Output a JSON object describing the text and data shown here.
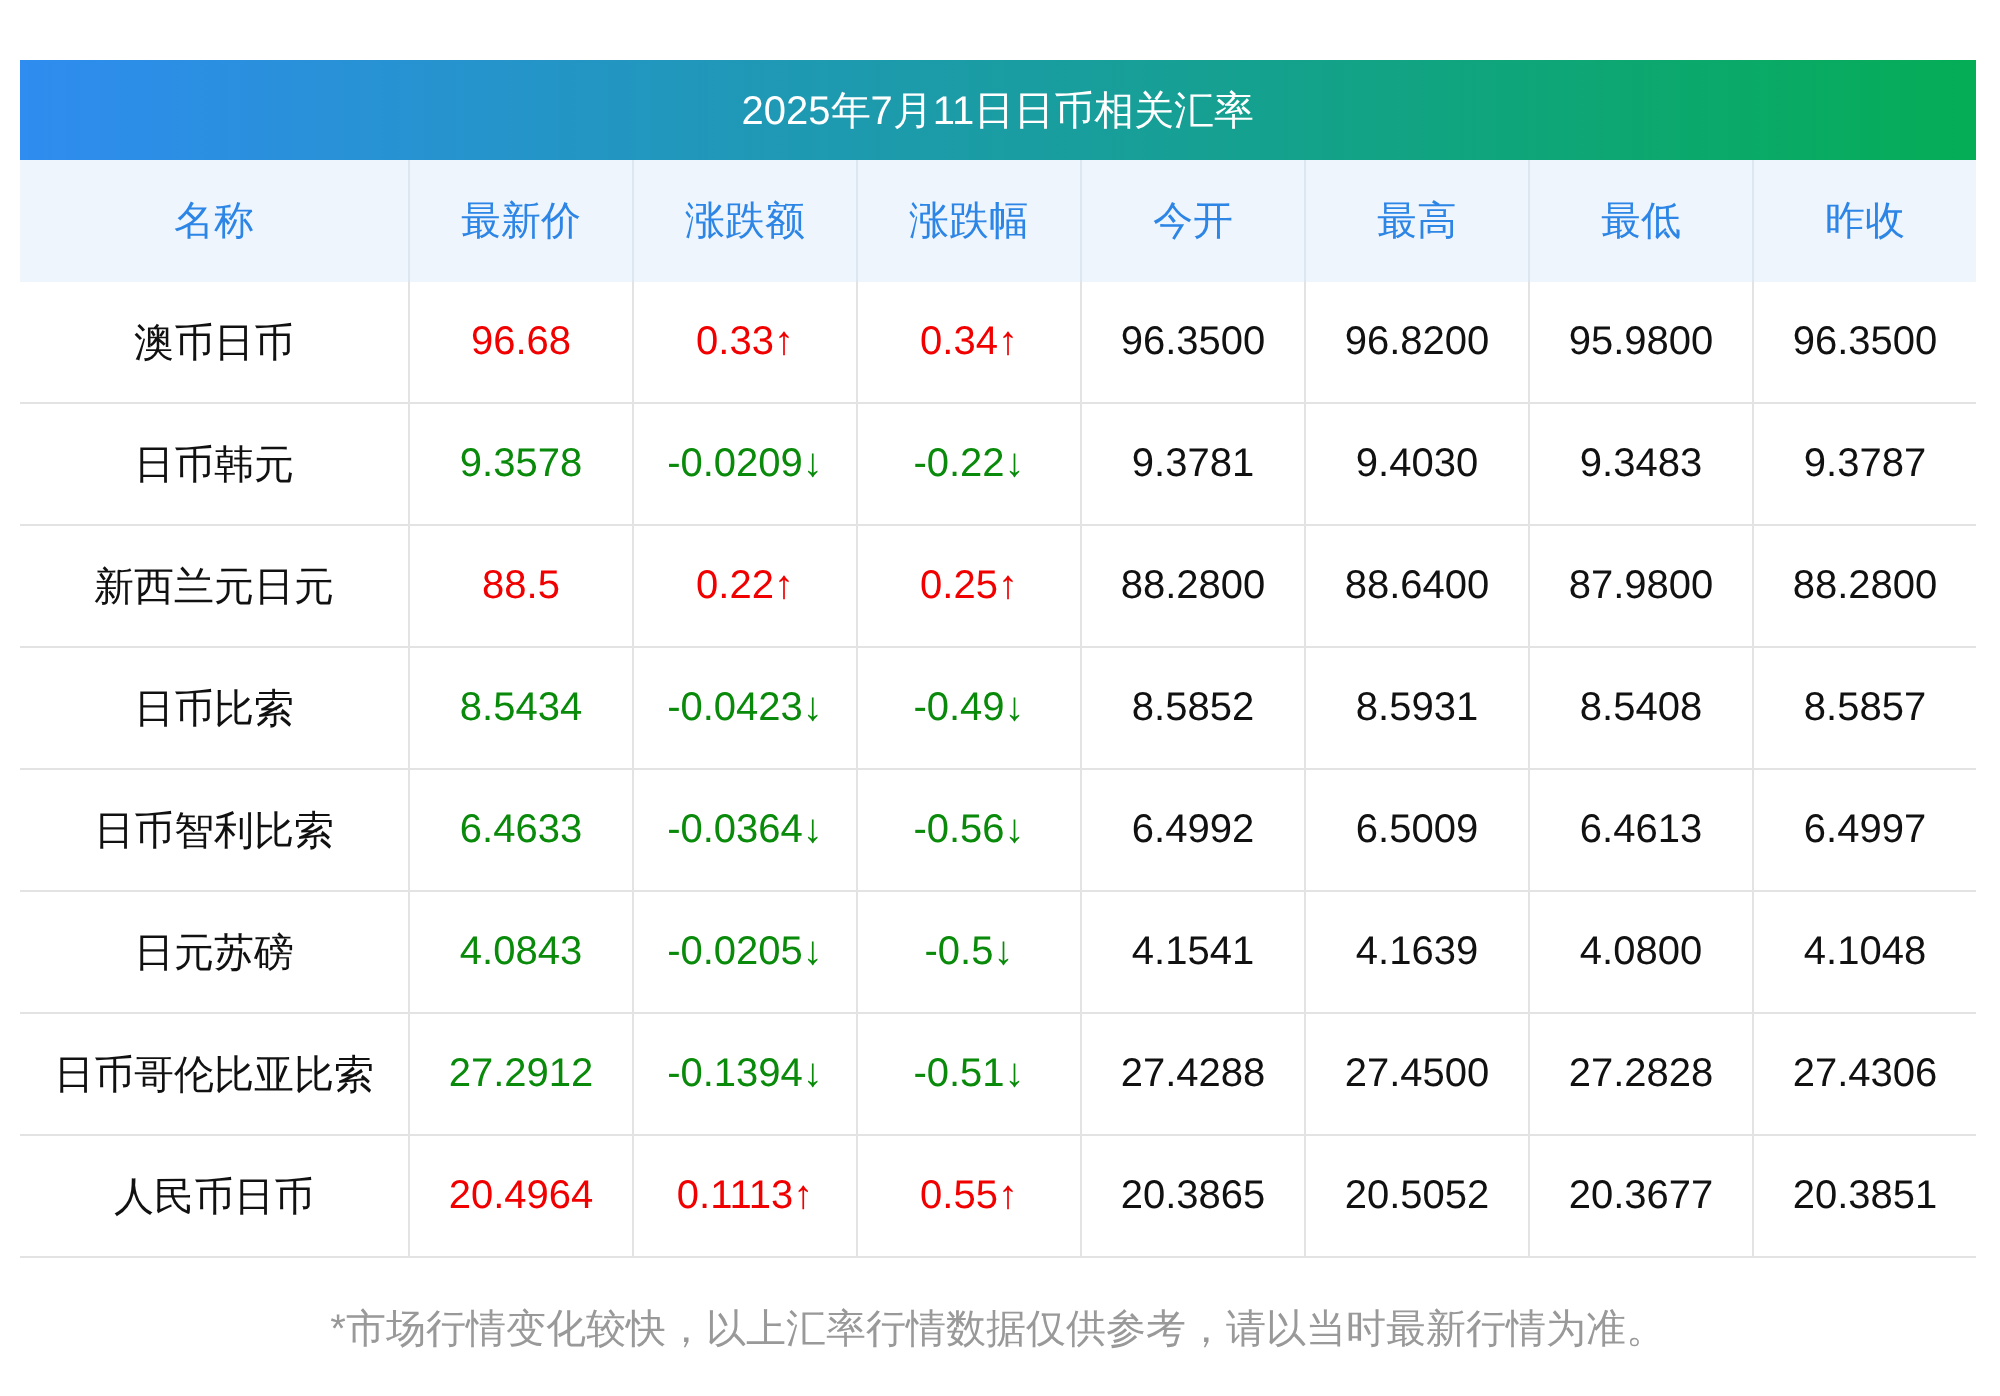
{
  "title": "2025年7月11日日币相关汇率",
  "columns": [
    "名称",
    "最新价",
    "涨跌额",
    "涨跌幅",
    "今开",
    "最高",
    "最低",
    "昨收"
  ],
  "rows": [
    {
      "color": "#f10000",
      "cells": [
        "澳币日币",
        "96.68",
        "0.33↑",
        "0.34↑",
        "96.3500",
        "96.8200",
        "95.9800",
        "96.3500"
      ]
    },
    {
      "color": "#0a8a0a",
      "cells": [
        "日币韩元",
        "9.3578",
        "-0.0209↓",
        "-0.22↓",
        "9.3781",
        "9.4030",
        "9.3483",
        "9.3787"
      ]
    },
    {
      "color": "#f10000",
      "cells": [
        "新西兰元日元",
        "88.5",
        "0.22↑",
        "0.25↑",
        "88.2800",
        "88.6400",
        "87.9800",
        "88.2800"
      ]
    },
    {
      "color": "#0a8a0a",
      "cells": [
        "日币比索",
        "8.5434",
        "-0.0423↓",
        "-0.49↓",
        "8.5852",
        "8.5931",
        "8.5408",
        "8.5857"
      ]
    },
    {
      "color": "#0a8a0a",
      "cells": [
        "日币智利比索",
        "6.4633",
        "-0.0364↓",
        "-0.56↓",
        "6.4992",
        "6.5009",
        "6.4613",
        "6.4997"
      ]
    },
    {
      "color": "#0a8a0a",
      "cells": [
        "日元苏磅",
        "4.0843",
        "-0.0205↓",
        "-0.5↓",
        "4.1541",
        "4.1639",
        "4.0800",
        "4.1048"
      ]
    },
    {
      "color": "#0a8a0a",
      "cells": [
        "日币哥伦比亚比索",
        "27.2912",
        "-0.1394↓",
        "-0.51↓",
        "27.4288",
        "27.4500",
        "27.2828",
        "27.4306"
      ]
    },
    {
      "color": "#f10000",
      "cells": [
        "人民币日币",
        "20.4964",
        "0.1113↑",
        "0.55↑",
        "20.3865",
        "20.5052",
        "20.3677",
        "20.3851"
      ]
    }
  ],
  "footnote": "*市场行情变化较快，以上汇率行情数据仅供参考，请以当时最新行情为准。"
}
